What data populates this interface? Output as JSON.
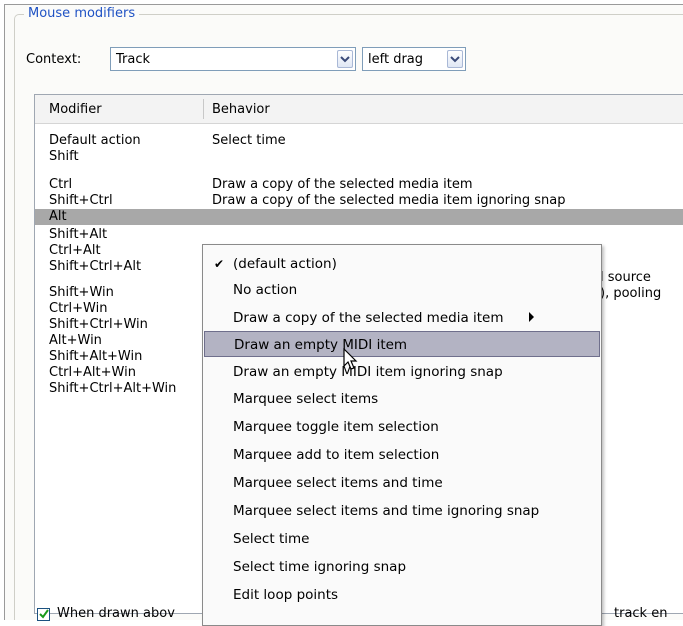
{
  "group_title": "Mouse modifiers",
  "context": {
    "label": "Context:",
    "value": "Track",
    "action_value": "left drag"
  },
  "columns": {
    "modifier": "Modifier",
    "behavior": "Behavior"
  },
  "rows": [
    {
      "modifier": "Default action",
      "behavior": "Select time"
    },
    {
      "modifier": "Shift",
      "behavior": ""
    },
    {
      "modifier": "Ctrl",
      "behavior": "Draw a copy of the selected media item"
    },
    {
      "modifier": "Shift+Ctrl",
      "behavior": "Draw a copy of the selected media item ignoring snap"
    },
    {
      "modifier": "Alt",
      "behavior": ""
    },
    {
      "modifier": "Shift+Alt",
      "behavior": ""
    },
    {
      "modifier": "Ctrl+Alt",
      "behavior": ""
    },
    {
      "modifier": "Shift+Ctrl+Alt",
      "behavior": ""
    },
    {
      "modifier": "Shift+Win",
      "behavior": ""
    },
    {
      "modifier": "Ctrl+Win",
      "behavior": ""
    },
    {
      "modifier": "Shift+Ctrl+Win",
      "behavior": ""
    },
    {
      "modifier": "Alt+Win",
      "behavior": ""
    },
    {
      "modifier": "Shift+Alt+Win",
      "behavior": ""
    },
    {
      "modifier": "Ctrl+Alt+Win",
      "behavior": ""
    },
    {
      "modifier": "Shift+Ctrl+Alt+Win",
      "behavior": ""
    }
  ],
  "clipped_text": {
    "row6": "l source",
    "row7": "), pooling",
    "bottom_left": "When drawn abov",
    "bottom_right": "track en"
  },
  "menu": {
    "items": [
      "(default action)",
      "No action",
      "Draw a copy of the selected media item",
      "Draw an empty MIDI item",
      "Draw an empty MIDI item ignoring snap",
      "Marquee select items",
      "Marquee toggle item selection",
      "Marquee add to item selection",
      "Marquee select items and time",
      "Marquee select items and time ignoring snap",
      "Select time",
      "Select time ignoring snap",
      "Edit loop points"
    ],
    "checked_item": "(default action)",
    "highlighted_item": "Draw an empty MIDI item",
    "submenu_item": "Draw a copy of the selected media item"
  },
  "icons": [
    "chevron-down-icon",
    "checkmark-icon",
    "submenu-arrow-icon",
    "mouse-cursor-icon"
  ],
  "colors": {
    "group_title": "#1f52c4",
    "selected_row": "#a8a8a8",
    "menu_highlight": "#b3b3c3"
  }
}
